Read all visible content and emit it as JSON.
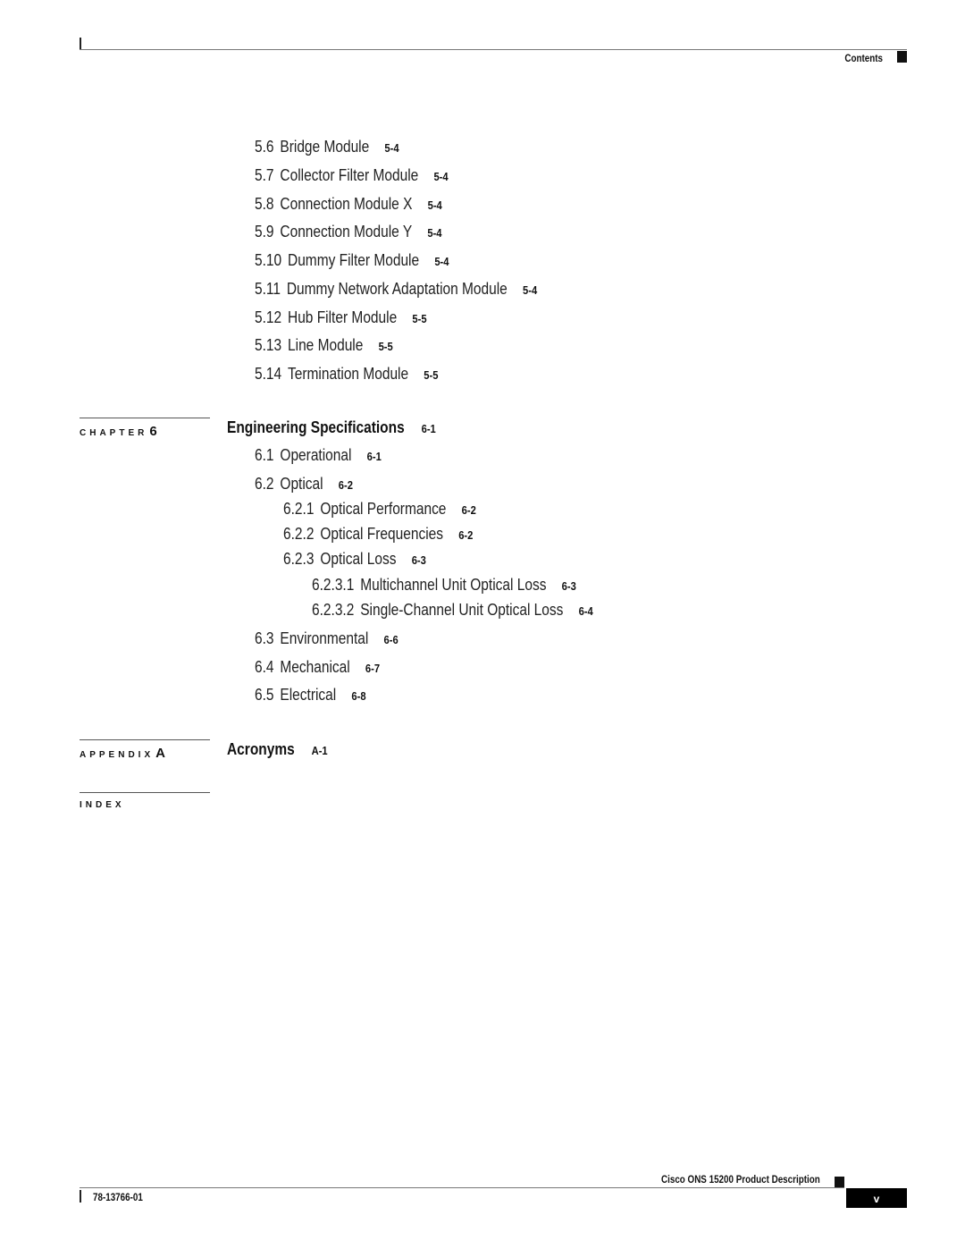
{
  "header": {
    "section_label": "Contents"
  },
  "chapter5_sections": [
    {
      "num": "5.6",
      "title": "Bridge Module",
      "page": "5-4"
    },
    {
      "num": "5.7",
      "title": "Collector Filter Module",
      "page": "5-4"
    },
    {
      "num": "5.8",
      "title": "Connection Module X",
      "page": "5-4"
    },
    {
      "num": "5.9",
      "title": "Connection Module Y",
      "page": "5-4"
    },
    {
      "num": "5.10",
      "title": "Dummy Filter Module",
      "page": "5-4"
    },
    {
      "num": "5.11",
      "title": "Dummy Network Adaptation Module",
      "page": "5-4"
    },
    {
      "num": "5.12",
      "title": "Hub Filter Module",
      "page": "5-5"
    },
    {
      "num": "5.13",
      "title": "Line Module",
      "page": "5-5"
    },
    {
      "num": "5.14",
      "title": "Termination Module",
      "page": "5-5"
    }
  ],
  "chapter6": {
    "label": "CHAPTER",
    "number": "6",
    "title": "Engineering Specifications",
    "page": "6-1",
    "sections": [
      {
        "num": "6.1",
        "title": "Operational",
        "page": "6-1"
      },
      {
        "num": "6.2",
        "title": "Optical",
        "page": "6-2"
      },
      {
        "num": "6.2.1",
        "title": "Optical Performance",
        "page": "6-2"
      },
      {
        "num": "6.2.2",
        "title": "Optical Frequencies",
        "page": "6-2"
      },
      {
        "num": "6.2.3",
        "title": "Optical Loss",
        "page": "6-3"
      },
      {
        "num": "6.2.3.1",
        "title": "Multichannel Unit Optical Loss",
        "page": "6-3"
      },
      {
        "num": "6.2.3.2",
        "title": "Single-Channel Unit Optical Loss",
        "page": "6-4"
      },
      {
        "num": "6.3",
        "title": "Environmental",
        "page": "6-6"
      },
      {
        "num": "6.4",
        "title": "Mechanical",
        "page": "6-7"
      },
      {
        "num": "6.5",
        "title": "Electrical",
        "page": "6-8"
      }
    ]
  },
  "appendixA": {
    "label": "APPENDIX",
    "letter": "A",
    "title": "Acronyms",
    "page": "A-1"
  },
  "index": {
    "label": "INDEX"
  },
  "footer": {
    "book_title": "Cisco ONS 15200 Product Description",
    "doc_number": "78-13766-01",
    "page_number": "v"
  }
}
